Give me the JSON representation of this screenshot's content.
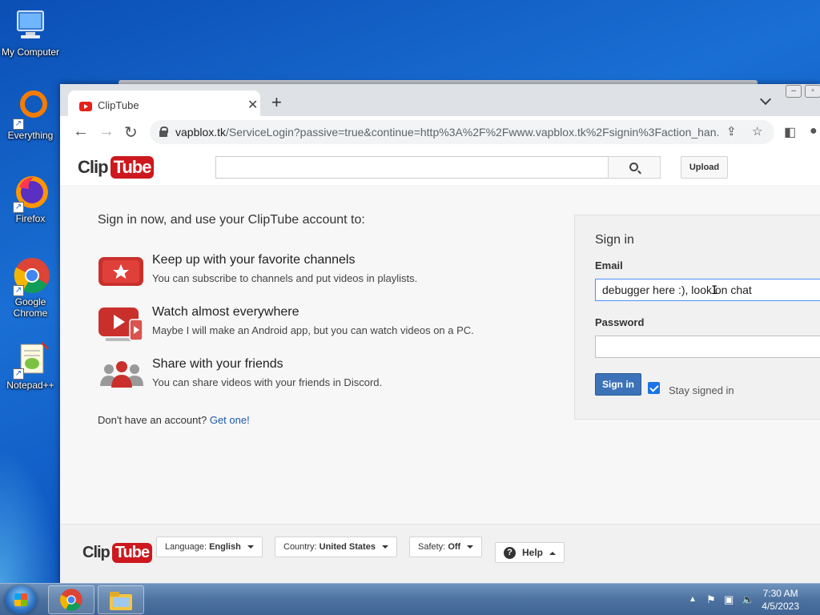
{
  "desktop": {
    "icons": [
      {
        "label": "My Computer"
      },
      {
        "label": "Everything"
      },
      {
        "label": "Firefox"
      },
      {
        "label": "Google Chrome"
      },
      {
        "label": "Notepad++"
      }
    ]
  },
  "browser": {
    "tab_title": "ClipTube",
    "tab_close": "✕",
    "new_tab": "+",
    "url_host": "vapblox.tk",
    "url_path": "/ServiceLogin?passive=true&continue=http%3A%2F%2Fwww.vapblox.tk%2Fsignin%3Faction_han..."
  },
  "site": {
    "logo_left": "Clip",
    "logo_right": "Tube",
    "upload_label": "Upload",
    "intro": "Sign in now, and use your ClipTube account to:",
    "features": [
      {
        "title": "Keep up with your favorite channels",
        "desc": "You can subscribe to channels and put videos in playlists."
      },
      {
        "title": "Watch almost everywhere",
        "desc": "Maybe I will make an Android app, but you can watch videos on a PC."
      },
      {
        "title": "Share with your friends",
        "desc": "You can share videos with your friends in Discord."
      }
    ],
    "no_account_text": "Don't have an account?",
    "get_one_link": "Get one!",
    "signin": {
      "title": "Sign in",
      "email_label": "Email",
      "email_value": "debugger here :), look on chat",
      "password_label": "Password",
      "password_value": "",
      "button_label": "Sign in",
      "stay_signed_in_label": "Stay signed in",
      "stay_signed_in_checked": true
    },
    "footer": {
      "language_label": "Language:",
      "language_value": "English",
      "country_label": "Country:",
      "country_value": "United States",
      "safety_label": "Safety:",
      "safety_value": "Off",
      "help_label": "Help"
    }
  },
  "taskbar": {
    "time": "7:30 AM",
    "date": "4/5/2023"
  },
  "colors": {
    "brand_red": "#cc181e",
    "link_blue": "#1b5aa8",
    "signin_button": "#3b72b8",
    "desktop_blue": "#1a6fd4"
  }
}
